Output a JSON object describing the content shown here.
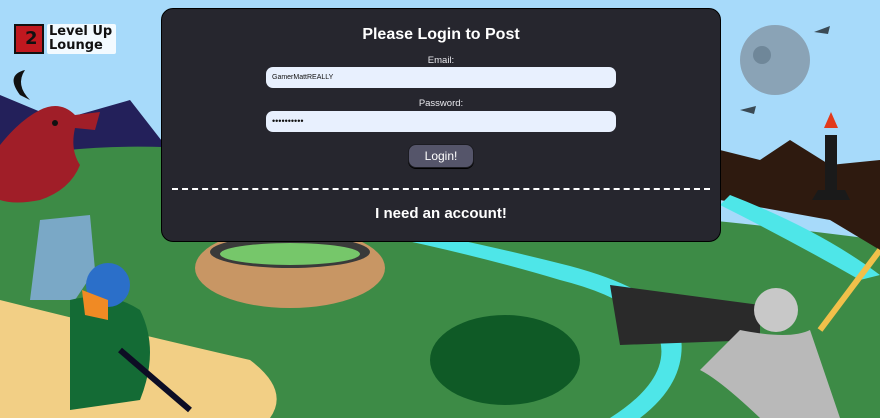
{
  "brand": {
    "line1": "Level Up",
    "line2": "Lounge"
  },
  "login": {
    "title": "Please Login to Post",
    "email_label": "Email:",
    "email_value": "GamerMattREALLY",
    "password_label": "Password:",
    "password_value": "••••••••••",
    "submit_label": "Login!",
    "signup_label": "I need an account!"
  },
  "colors": {
    "panel": "#26262e",
    "sky": "#a7dafa",
    "grass": "#3d8b46",
    "input": "#e8f0fe",
    "button": "#55556a"
  }
}
